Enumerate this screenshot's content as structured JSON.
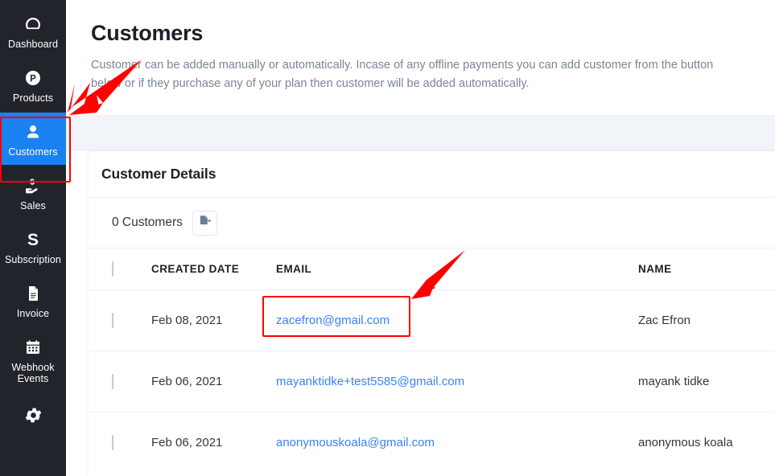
{
  "sidebar": {
    "items": [
      {
        "label": "Dashboard",
        "icon": "gauge-icon",
        "active": false
      },
      {
        "label": "Products",
        "icon": "p-circle-icon",
        "active": false
      },
      {
        "label": "Customers",
        "icon": "user-icon",
        "active": true
      },
      {
        "label": "Sales",
        "icon": "hand-money-icon",
        "active": false
      },
      {
        "label": "Subscription",
        "icon": "s-letter-icon",
        "active": false
      },
      {
        "label": "Invoice",
        "icon": "document-icon",
        "active": false
      },
      {
        "label": "Webhook Events",
        "icon": "calendar-icon",
        "active": false
      },
      {
        "label": "",
        "icon": "gear-icon",
        "active": false
      }
    ],
    "active_bg": "#1a82f0",
    "bg": "#21252b"
  },
  "page": {
    "title": "Customers",
    "description": "Customer can be added manually or automatically. Incase of any offline payments you can add customer from the button below or if they purchase any of your plan then customer will be added automatically."
  },
  "card": {
    "title": "Customer Details",
    "count_label": "0 Customers",
    "export_icon": "export-file-icon"
  },
  "table": {
    "headers": [
      "",
      "CREATED DATE",
      "EMAIL",
      "NAME"
    ],
    "rows": [
      {
        "date": "Feb 08, 2021",
        "email": "zacefron@gmail.com",
        "name": "Zac Efron"
      },
      {
        "date": "Feb 06, 2021",
        "email": "mayanktidke+test5585@gmail.com",
        "name": "mayank tidke"
      },
      {
        "date": "Feb 06, 2021",
        "email": "anonymouskoala@gmail.com",
        "name": "anonymous koala"
      }
    ]
  },
  "annotations": {
    "color": "#ff0000",
    "highlight_boxes": [
      "sidebar-customers",
      "email-zacefron"
    ],
    "arrows": [
      "arrow-to-customers-nav",
      "arrow-to-email-link"
    ]
  }
}
